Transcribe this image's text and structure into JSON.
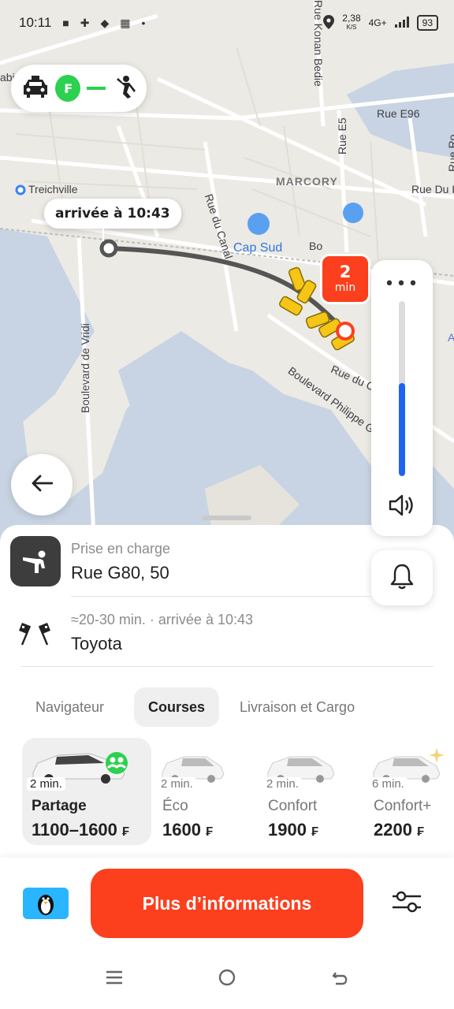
{
  "status_bar": {
    "time": "10:11",
    "network_speed": "2,38",
    "network_speed_unit": "K/S",
    "network_type": "4G+",
    "battery": "93"
  },
  "map": {
    "labels": {
      "treichville": "Treichville",
      "marcory": "MARCORY",
      "cap_sud": "Cap Sud",
      "rue_e96": "Rue E96",
      "rue_e5": "Rue E5",
      "rue_du_canal": "Rue du Canal",
      "boulevard_vridi": "Boulevard de Vridi",
      "rue_konan_bedie": "Rue Konan Bedie",
      "boulevard_philippe": "Boulevard Philippe Gré",
      "rue_du_p": "Rue Du P",
      "rue_du_c": "Rue du C",
      "rue_r": "Rue Ro",
      "au_de_gaulle": "AU de Gaulle",
      "abi": "abi",
      "bo": "Bo",
      "a": "A"
    },
    "arrival_bubble": "arrivée à 10:43",
    "eta_badge": {
      "value": "2",
      "unit": "min"
    },
    "route_pill": {
      "fare_symbol": "₣"
    },
    "volume_level": 0.53
  },
  "pickup": {
    "label": "Prise en charge",
    "address": "Rue G80, 50"
  },
  "destination": {
    "info": "≈20-30 min. · arrivée à 10:43",
    "name": "Toyota"
  },
  "tabs": [
    {
      "label": "Navigateur"
    },
    {
      "label": "Courses"
    },
    {
      "label": "Livraison et Cargo"
    }
  ],
  "tariffs": [
    {
      "eta": "2 min.",
      "name": "Partage",
      "price": "1100–1600",
      "currency": "₣"
    },
    {
      "eta": "2 min.",
      "name": "Éco",
      "price": "1600",
      "currency": "₣"
    },
    {
      "eta": "2 min.",
      "name": "Confort",
      "price": "1900",
      "currency": "₣"
    },
    {
      "eta": "6 min.",
      "name": "Confort+",
      "price": "2200",
      "currency": "₣"
    }
  ],
  "cta": {
    "label": "Plus d’informations"
  },
  "colors": {
    "accent": "#fc3f1d",
    "fare_green": "#2bd14f",
    "volume_blue": "#1e63f0"
  }
}
